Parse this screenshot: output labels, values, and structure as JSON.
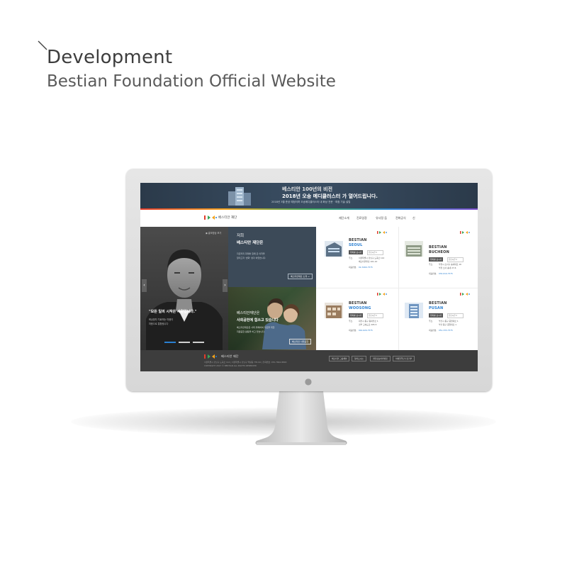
{
  "heading": {
    "title": "Development",
    "subtitle": "Bestian Foundation Official Website"
  },
  "site": {
    "banner": {
      "line1": "베스티안 100년의 비전",
      "line2": "2018년 오송 메디클러스터 가 열어드립니다.",
      "line3": "2018년 3월 준공 예정이며 오송메디클러스터 내 화상 전문 · 최첨 기술 설립"
    },
    "nav": {
      "logo_text": "베스티안 재단",
      "items": [
        "재단소개",
        "진료일정",
        "유사정 듭",
        "전화공식",
        "신"
      ]
    },
    "hero": {
      "tag": "홍보영상 보기",
      "quote": "\"모든 일의 시작은 사람입니다.\"",
      "sub1": "화상환자 치료에는 마음이",
      "sub2": "마음으로 통합됩니다",
      "arrow_left": "‹",
      "arrow_right": "›",
      "panel_top": {
        "title1": "저희",
        "title2": "베스티안 재단은",
        "body1": "지금까지 화재와 함께 온 의학을",
        "body2": "알리고자 '변화' 생각 하였습니다.",
        "button": "베스티안재단 소개 →"
      },
      "panel_bottom": {
        "title1": "베스티안재단은",
        "title2": "사회공헌에 힘쓰고 있습니다",
        "body1": "베스티안재단은 사회 위해하여 꾸준을 위한",
        "body2": "지원공헌 활동을 하고 있습니다.",
        "button": "베스티안 사회공헌"
      }
    },
    "branches": [
      {
        "name": "BESTIAN",
        "city": "SEOUL",
        "city_color": "#2a7fd1",
        "button": "위치를 보시기",
        "select": "진료시간",
        "addr_label": "주소.",
        "addr1": "서울특별시 강남구 도곡로 112",
        "addr2": "베스티안빌딩 101-10",
        "tel_label": "대표번호.",
        "tel": "02-3460-7575"
      },
      {
        "name": "BESTIAN",
        "city": "BUCHEON",
        "city_color": "#333333",
        "button": "위치를 보시기",
        "select": "진료시간",
        "addr_label": "주소.",
        "addr1": "부천시 소사구 송내대로 16",
        "addr2": "부천 소사 송내 27-6",
        "tel_label": "대표번호.",
        "tel": "032-610-7575"
      },
      {
        "name": "BESTIAN",
        "city": "WOOSONG",
        "city_color": "#2a7fd1",
        "button": "위치를 보시기",
        "select": "진료시간",
        "addr_label": "주소.",
        "addr1": "대전시 동구 동대전로 1",
        "addr2": "경부 고속도로 205-5",
        "tel_label": "대표번호.",
        "tel": "042-620-7575"
      },
      {
        "name": "BESTIAN",
        "city": "PUSAN",
        "city_color": "#2a7fd1",
        "button": "위치를 보시기",
        "select": "진료시간",
        "addr_label": "주소.",
        "addr1": "부산시 동구 중앙대로 1",
        "addr2": "부산 동구 중앙대로 1",
        "tel_label": "대표번호.",
        "tel": "051-333-7575"
      }
    ],
    "footer": {
      "logo_text": "베스티안 재단",
      "line1": "서울특별시 강남구 도곡로 112 | 서울특별시 강남구 역삼동 735-94 | 전화번호: 070-7662-8800",
      "line2": "COPYRIGHT 2017 © BESTIAN ALL RIGHTS RESERVED",
      "buttons": [
        "베스티안 그룹채널",
        "찾아오시는",
        "개인정보처리방침",
        "이메일무단수집거부"
      ]
    }
  }
}
